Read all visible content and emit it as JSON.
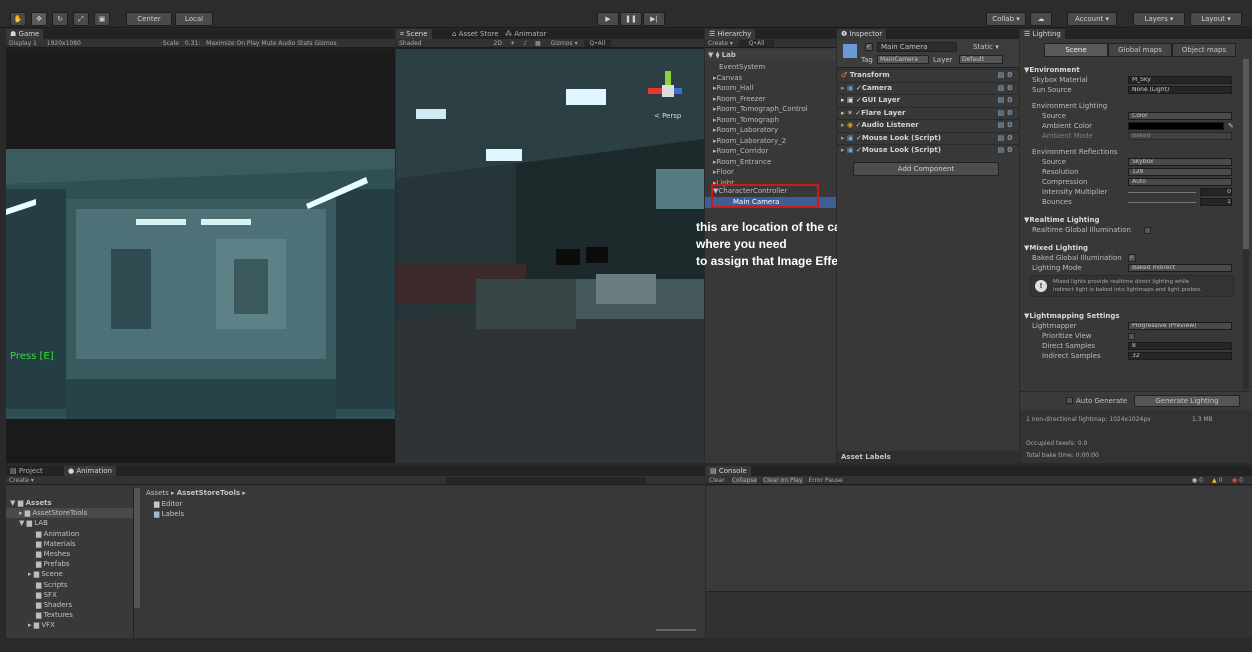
{
  "toolbar": {
    "pivot_center": "Center",
    "pivot_local": "Local",
    "collab": "Collab ▾",
    "account": "Account ▾",
    "layers": "Layers ▾",
    "layout": "Layout ▾"
  },
  "game": {
    "tab": "Game",
    "display": "Display 1",
    "resolution": "1920x1080",
    "scale_label": "Scale",
    "scale_value": "0.31:",
    "options": "Maximize On Play  Mute Audio  Stats  Gizmos",
    "press_text": "Press [E]"
  },
  "scene": {
    "tabs": [
      "Scene",
      "Asset Store",
      "Animator"
    ],
    "shading": "Shaded",
    "mode_2d": "2D",
    "gizmos": "Gizmos ▾",
    "search_placeholder": "Q•All",
    "persp": "< Persp"
  },
  "hierarchy": {
    "tab": "Hierarchy",
    "create": "Create ▾",
    "search_placeholder": "Q•All",
    "scene_name": "Lab",
    "items": [
      "EventSystem",
      "Canvas",
      "Room_Hall",
      "Room_Freezer",
      "Room_Tomograph_Control",
      "Room_Tomograph",
      "Room_Laboratory",
      "Room_Laboratory_2",
      "Room_Corridor",
      "Room_Entrance",
      "Floor",
      "Light"
    ],
    "controller": "CharacterController",
    "camera": "Main Camera"
  },
  "annotation": {
    "line1": "this are location of the camera",
    "line2": "where you need",
    "line3": "to assign that Image Effects"
  },
  "inspector": {
    "tab": "Inspector",
    "object_name": "Main Camera",
    "static_label": "Static ▾",
    "tag_label": "Tag",
    "tag_value": "MainCamera",
    "layer_label": "Layer",
    "layer_value": "Default",
    "components": [
      "Transform",
      "Camera",
      "GUI Layer",
      "Flare Layer",
      "Audio Listener",
      "Mouse Look (Script)",
      "Mouse Look (Script)"
    ],
    "add_component": "Add Component",
    "asset_labels": "Asset Labels"
  },
  "lighting": {
    "tab": "Lighting",
    "tabs": [
      "Scene",
      "Global maps",
      "Object maps"
    ],
    "environment": {
      "title": "Environment",
      "skybox_label": "Skybox Material",
      "skybox_value": "M_Sky",
      "sun_label": "Sun Source",
      "sun_value": "None (Light)",
      "env_lighting": "Environment Lighting",
      "source_label": "Source",
      "source_value": "Color",
      "ambient_label": "Ambient Color",
      "ambient_mode_label": "Ambient Mode",
      "ambient_mode_value": "Baked",
      "reflections": "Environment Reflections",
      "refl_source_label": "Source",
      "refl_source_value": "Skybox",
      "resolution_label": "Resolution",
      "resolution_value": "128",
      "compression_label": "Compression",
      "compression_value": "Auto",
      "intensity_label": "Intensity Multiplier",
      "intensity_value": "0",
      "bounces_label": "Bounces",
      "bounces_value": "1"
    },
    "realtime": {
      "title": "Realtime Lighting",
      "gi_label": "Realtime Global Illumination"
    },
    "mixed": {
      "title": "Mixed Lighting",
      "baked_gi_label": "Baked Global Illumination",
      "mode_label": "Lighting Mode",
      "mode_value": "Baked Indirect",
      "info_line1": "Mixed lights provide realtime direct lighting while",
      "info_line2": "indirect light is baked into lightmaps and light probes."
    },
    "lightmapping": {
      "title": "Lightmapping Settings",
      "lightmapper_label": "Lightmapper",
      "lightmapper_value": "Progressive (Preview)",
      "prioritize_label": "Prioritize View",
      "direct_label": "Direct Samples",
      "direct_value": "8",
      "indirect_label": "Indirect Samples",
      "indirect_value": "32"
    },
    "auto_generate": "Auto Generate",
    "generate_button": "Generate Lighting",
    "stats_line": "1 non-directional lightmap: 1024x1024px",
    "stats_size": "1.3 MB",
    "occupied": "Occupied texels: 0.0",
    "bake_time": "Total bake time: 0:00:00"
  },
  "project": {
    "tabs": [
      "Project",
      "Animation"
    ],
    "create": "Create ▾",
    "tree": [
      "Assets",
      "AssetStoreTools",
      "LAB",
      "Animation",
      "Materials",
      "Meshes",
      "Prefabs",
      "Scene",
      "Scripts",
      "SFX",
      "Shaders",
      "Textures",
      "VFX"
    ],
    "breadcrumb_root": "Assets",
    "breadcrumb_folder": "AssetStoreTools",
    "files": [
      "Editor",
      "Labels"
    ]
  },
  "console": {
    "tab": "Console",
    "buttons": [
      "Clear",
      "Collapse",
      "Clear on Play",
      "Error Pause"
    ],
    "count_log": "0",
    "count_warn": "0",
    "count_err": "0"
  },
  "colors": {
    "annotation_box": "#d01818",
    "press_text": "#33dd33",
    "selected": "#3e5f96"
  }
}
